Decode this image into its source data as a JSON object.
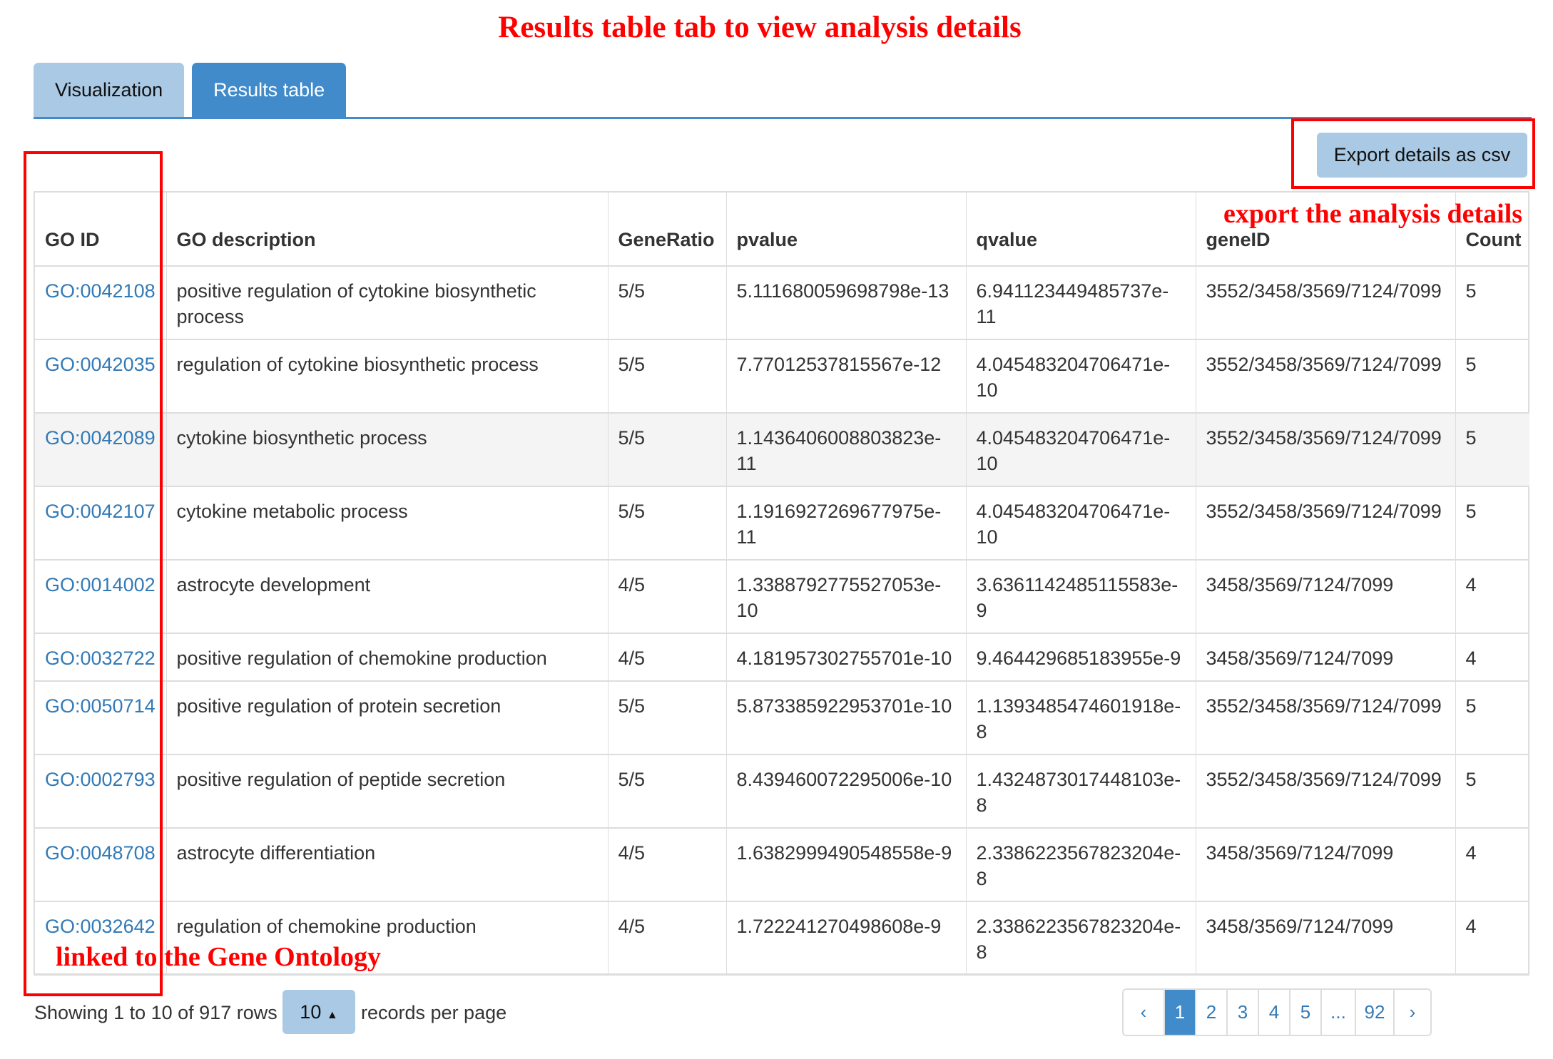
{
  "annotations": {
    "title": "Results table tab to view analysis details",
    "export_note": "export the analysis details",
    "linked_note": "linked to the Gene Ontology"
  },
  "tabs": [
    {
      "label": "Visualization",
      "active": false
    },
    {
      "label": "Results table",
      "active": true
    }
  ],
  "toolbar": {
    "export_label": "Export details as csv"
  },
  "table": {
    "headers": [
      "GO ID",
      "GO description",
      "GeneRatio",
      "pvalue",
      "qvalue",
      "geneID",
      "Count"
    ],
    "rows": [
      {
        "go_id": "GO:0042108",
        "description": "positive regulation of cytokine biosynthetic process",
        "gene_ratio": "5/5",
        "pvalue": "5.111680059698798e-13",
        "qvalue": "6.941123449485737e-11",
        "gene_id": "3552/3458/3569/7124/7099",
        "count": "5"
      },
      {
        "go_id": "GO:0042035",
        "description": "regulation of cytokine biosynthetic process",
        "gene_ratio": "5/5",
        "pvalue": "7.77012537815567e-12",
        "qvalue": "4.045483204706471e-10",
        "gene_id": "3552/3458/3569/7124/7099",
        "count": "5"
      },
      {
        "go_id": "GO:0042089",
        "description": "cytokine biosynthetic process",
        "gene_ratio": "5/5",
        "pvalue": "1.1436406008803823e-11",
        "qvalue": "4.045483204706471e-10",
        "gene_id": "3552/3458/3569/7124/7099",
        "count": "5"
      },
      {
        "go_id": "GO:0042107",
        "description": "cytokine metabolic process",
        "gene_ratio": "5/5",
        "pvalue": "1.1916927269677975e-11",
        "qvalue": "4.045483204706471e-10",
        "gene_id": "3552/3458/3569/7124/7099",
        "count": "5"
      },
      {
        "go_id": "GO:0014002",
        "description": "astrocyte development",
        "gene_ratio": "4/5",
        "pvalue": "1.3388792775527053e-10",
        "qvalue": "3.6361142485115583e-9",
        "gene_id": "3458/3569/7124/7099",
        "count": "4"
      },
      {
        "go_id": "GO:0032722",
        "description": "positive regulation of chemokine production",
        "gene_ratio": "4/5",
        "pvalue": "4.181957302755701e-10",
        "qvalue": "9.464429685183955e-9",
        "gene_id": "3458/3569/7124/7099",
        "count": "4"
      },
      {
        "go_id": "GO:0050714",
        "description": "positive regulation of protein secretion",
        "gene_ratio": "5/5",
        "pvalue": "5.873385922953701e-10",
        "qvalue": "1.1393485474601918e-8",
        "gene_id": "3552/3458/3569/7124/7099",
        "count": "5"
      },
      {
        "go_id": "GO:0002793",
        "description": "positive regulation of peptide secretion",
        "gene_ratio": "5/5",
        "pvalue": "8.439460072295006e-10",
        "qvalue": "1.4324873017448103e-8",
        "gene_id": "3552/3458/3569/7124/7099",
        "count": "5"
      },
      {
        "go_id": "GO:0048708",
        "description": "astrocyte differentiation",
        "gene_ratio": "4/5",
        "pvalue": "1.6382999490548558e-9",
        "qvalue": "2.3386223567823204e-8",
        "gene_id": "3458/3569/7124/7099",
        "count": "4"
      },
      {
        "go_id": "GO:0032642",
        "description": "regulation of chemokine production",
        "gene_ratio": "4/5",
        "pvalue": "1.722241270498608e-9",
        "qvalue": "2.3386223567823204e-8",
        "gene_id": "3458/3569/7124/7099",
        "count": "4"
      }
    ]
  },
  "footer": {
    "showing": "Showing 1 to 10 of 917 rows",
    "per_page_value": "10",
    "per_page_label": "records per page"
  },
  "pagination": {
    "prev": "‹",
    "pages": [
      "1",
      "2",
      "3",
      "4",
      "5",
      "...",
      "92"
    ],
    "active_page": "1",
    "next": "›"
  },
  "colors": {
    "annotation": "#ff0000",
    "link": "#337ab7",
    "primary": "#428bca",
    "tab_inactive": "#a9c9e4"
  }
}
